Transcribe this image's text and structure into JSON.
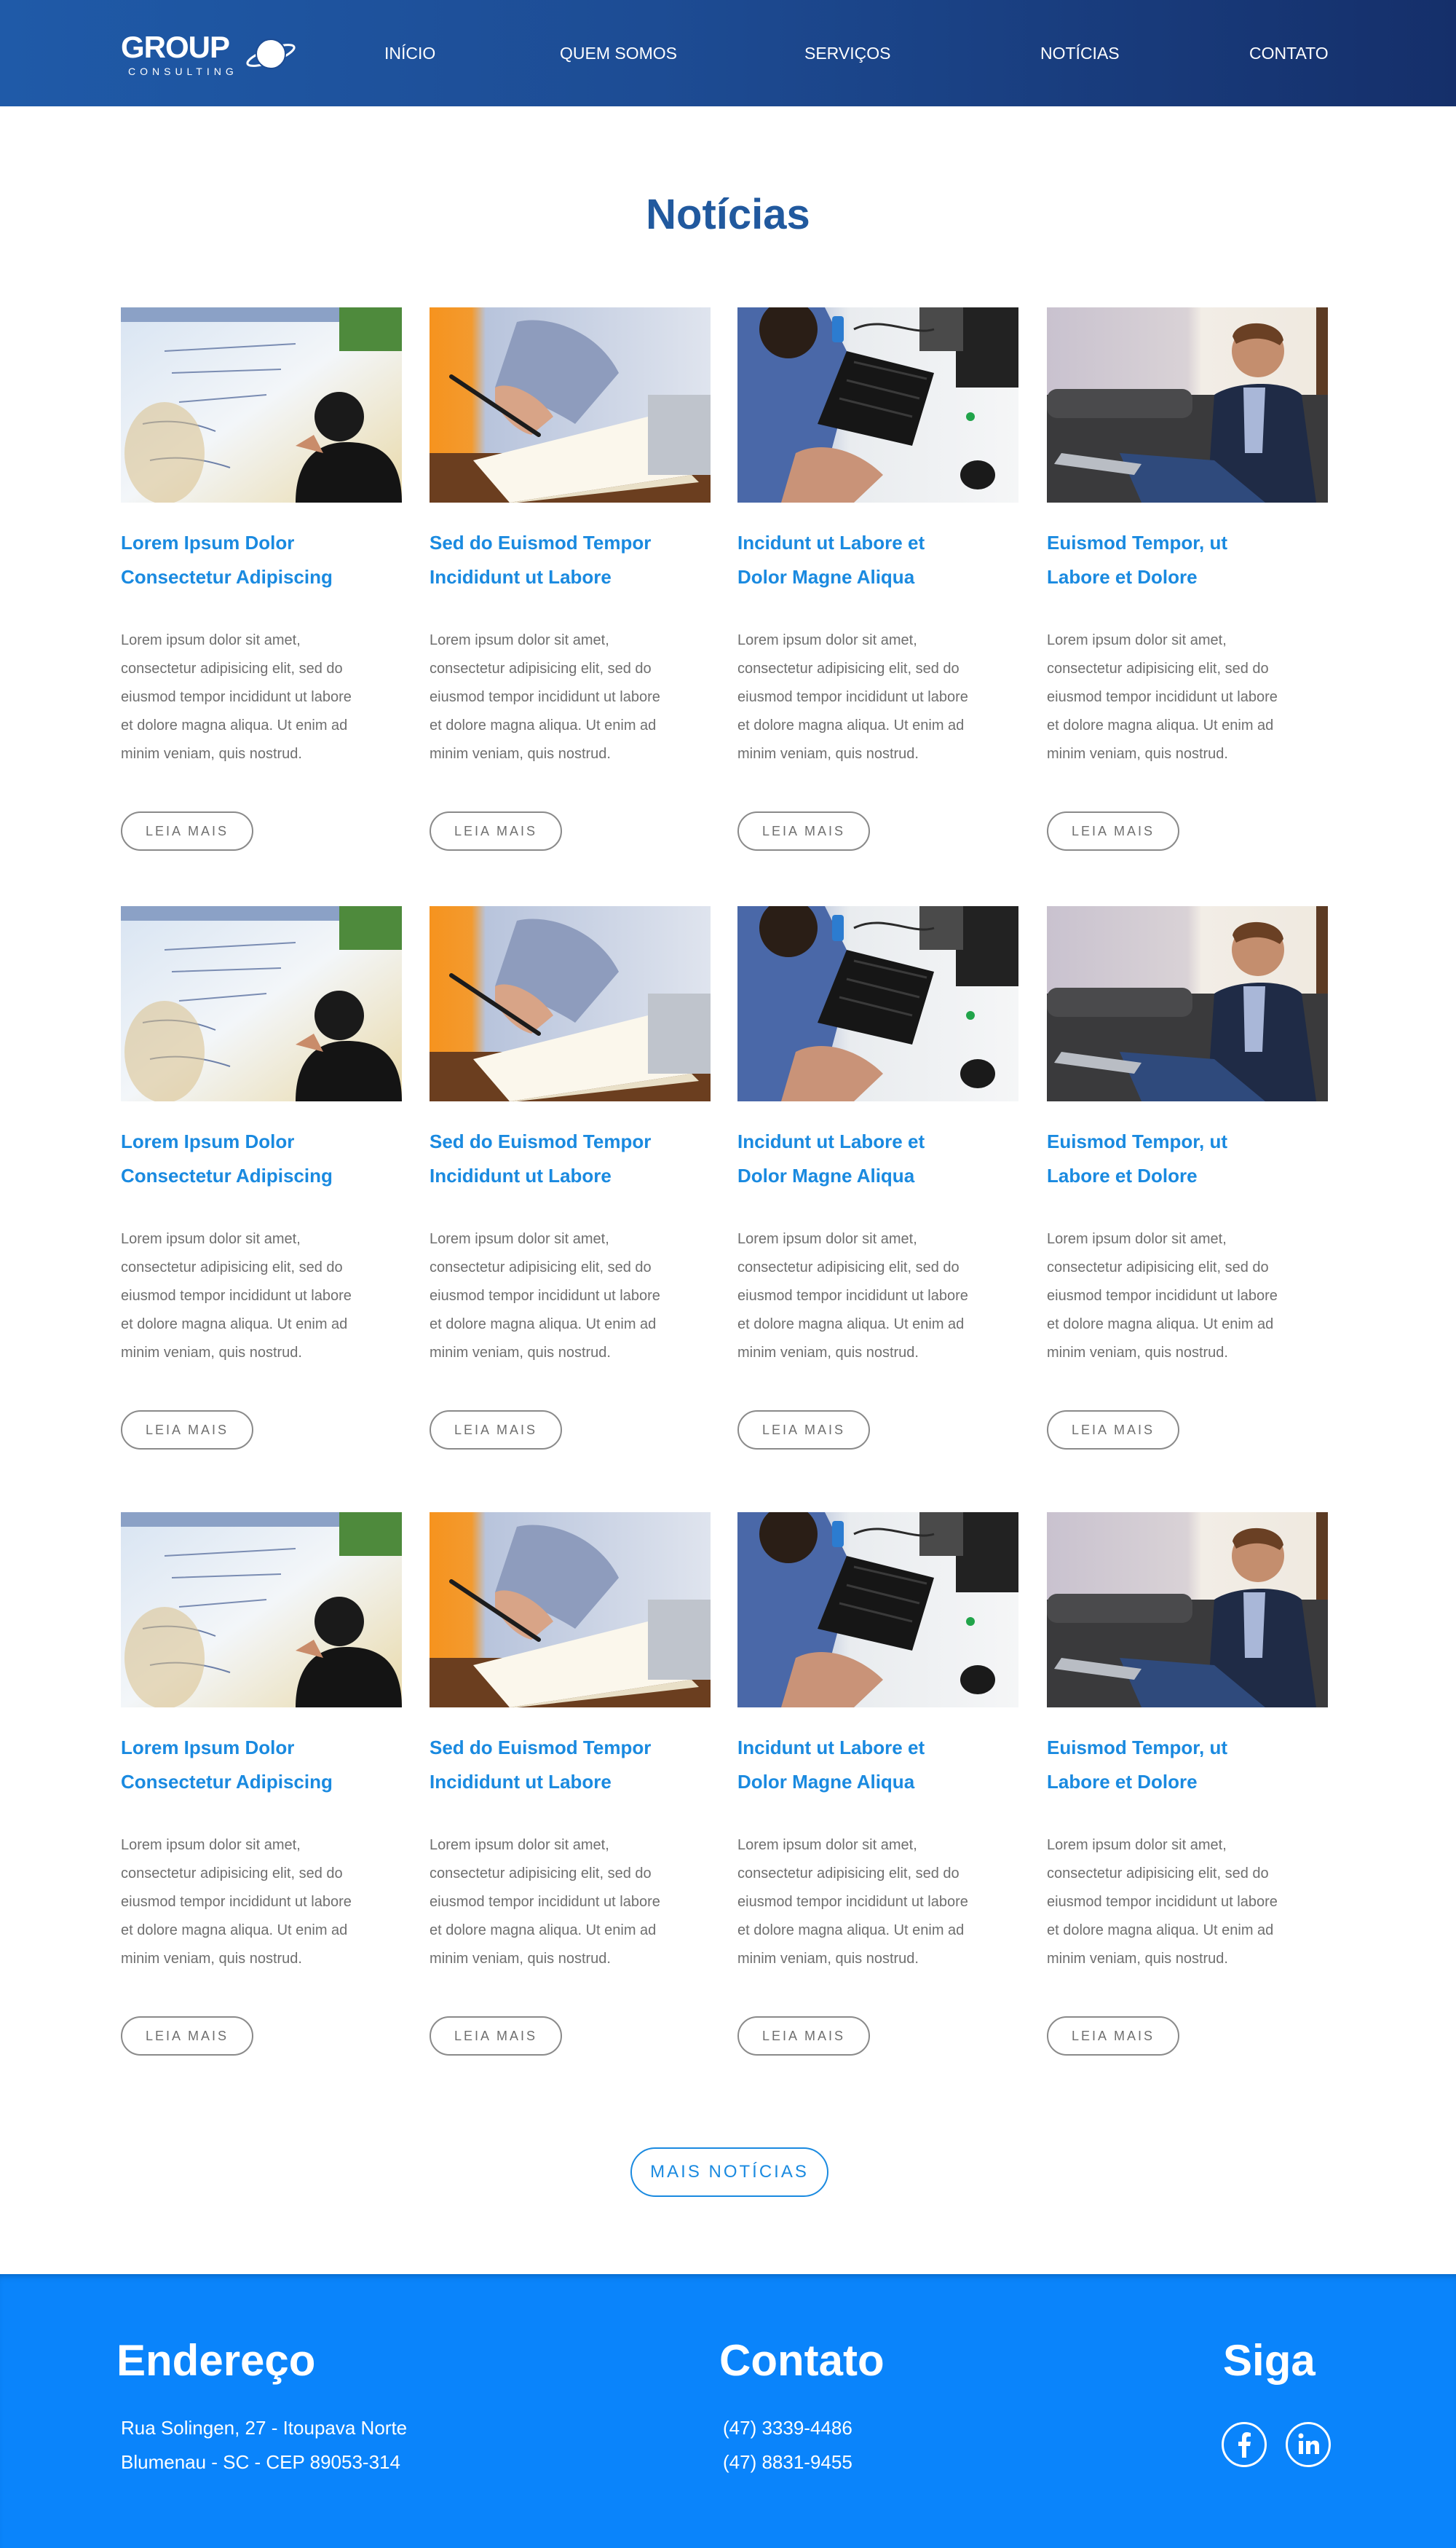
{
  "header": {
    "logo_text": "GROUP",
    "logo_sub": "CONSULTING",
    "nav": [
      "INÍCIO",
      "QUEM SOMOS",
      "SERVIÇOS",
      "NOTÍCIAS",
      "CONTATO"
    ]
  },
  "main": {
    "title": "Notícias",
    "more_label": "MAIS NOTÍCIAS",
    "rows": [
      [
        {
          "image": "whiteboard-photo",
          "title_1": "Lorem Ipsum Dolor",
          "title_2": "Consectetur Adipiscing",
          "text_1": "Lorem ipsum dolor sit amet,",
          "text_2": "consectetur adipisicing elit, sed do",
          "text_3": "eiusmod tempor incididunt ut labore",
          "text_4": "et dolore magna aliqua. Ut enim ad",
          "text_5": "minim veniam, quis nostrud.",
          "button": "LEIA MAIS"
        },
        {
          "image": "writing-photo",
          "title_1": "Sed do Euismod Tempor",
          "title_2": "Incididunt ut Labore",
          "text_1": "Lorem ipsum dolor sit amet,",
          "text_2": "consectetur adipisicing elit, sed do",
          "text_3": "eiusmod tempor incididunt ut labore",
          "text_4": "et dolore magna aliqua. Ut enim ad",
          "text_5": "minim veniam, quis nostrud.",
          "button": "LEIA MAIS"
        },
        {
          "image": "keyboard-photo",
          "title_1": "Incidunt ut Labore et",
          "title_2": "Dolor Magne Aliqua",
          "text_1": "Lorem ipsum dolor sit amet,",
          "text_2": "consectetur adipisicing elit, sed do",
          "text_3": "eiusmod tempor incididunt ut labore",
          "text_4": "et dolore magna aliqua. Ut enim ad",
          "text_5": "minim veniam, quis nostrud.",
          "button": "LEIA MAIS"
        },
        {
          "image": "laptop-man-photo",
          "title_1": "Euismod Tempor, ut",
          "title_2": "Labore et Dolore",
          "text_1": "Lorem ipsum dolor sit amet,",
          "text_2": "consectetur adipisicing elit, sed do",
          "text_3": "eiusmod tempor incididunt ut labore",
          "text_4": "et dolore magna aliqua. Ut enim ad",
          "text_5": "minim veniam, quis nostrud.",
          "button": "LEIA MAIS"
        }
      ],
      [
        {
          "image": "whiteboard-photo",
          "title_1": "Lorem Ipsum Dolor",
          "title_2": "Consectetur Adipiscing",
          "text_1": "Lorem ipsum dolor sit amet,",
          "text_2": "consectetur adipisicing elit, sed do",
          "text_3": "eiusmod tempor incididunt ut labore",
          "text_4": "et dolore magna aliqua. Ut enim ad",
          "text_5": "minim veniam, quis nostrud.",
          "button": "LEIA MAIS"
        },
        {
          "image": "writing-photo",
          "title_1": "Sed do Euismod Tempor",
          "title_2": "Incididunt ut Labore",
          "text_1": "Lorem ipsum dolor sit amet,",
          "text_2": "consectetur adipisicing elit, sed do",
          "text_3": "eiusmod tempor incididunt ut labore",
          "text_4": "et dolore magna aliqua. Ut enim ad",
          "text_5": "minim veniam, quis nostrud.",
          "button": "LEIA MAIS"
        },
        {
          "image": "keyboard-photo",
          "title_1": "Incidunt ut Labore et",
          "title_2": "Dolor Magne Aliqua",
          "text_1": "Lorem ipsum dolor sit amet,",
          "text_2": "consectetur adipisicing elit, sed do",
          "text_3": "eiusmod tempor incididunt ut labore",
          "text_4": "et dolore magna aliqua. Ut enim ad",
          "text_5": "minim veniam, quis nostrud.",
          "button": "LEIA MAIS"
        },
        {
          "image": "laptop-man-photo",
          "title_1": "Euismod Tempor, ut",
          "title_2": "Labore et Dolore",
          "text_1": "Lorem ipsum dolor sit amet,",
          "text_2": "consectetur adipisicing elit, sed do",
          "text_3": "eiusmod tempor incididunt ut labore",
          "text_4": "et dolore magna aliqua. Ut enim ad",
          "text_5": "minim veniam, quis nostrud.",
          "button": "LEIA MAIS"
        }
      ],
      [
        {
          "image": "whiteboard-photo",
          "title_1": "Lorem Ipsum Dolor",
          "title_2": "Consectetur Adipiscing",
          "text_1": "Lorem ipsum dolor sit amet,",
          "text_2": "consectetur adipisicing elit, sed do",
          "text_3": "eiusmod tempor incididunt ut labore",
          "text_4": "et dolore magna aliqua. Ut enim ad",
          "text_5": "minim veniam, quis nostrud.",
          "button": "LEIA MAIS"
        },
        {
          "image": "writing-photo",
          "title_1": "Sed do Euismod Tempor",
          "title_2": "Incididunt ut Labore",
          "text_1": "Lorem ipsum dolor sit amet,",
          "text_2": "consectetur adipisicing elit, sed do",
          "text_3": "eiusmod tempor incididunt ut labore",
          "text_4": "et dolore magna aliqua. Ut enim ad",
          "text_5": "minim veniam, quis nostrud.",
          "button": "LEIA MAIS"
        },
        {
          "image": "keyboard-photo",
          "title_1": "Incidunt ut Labore et",
          "title_2": "Dolor Magne Aliqua",
          "text_1": "Lorem ipsum dolor sit amet,",
          "text_2": "consectetur adipisicing elit, sed do",
          "text_3": "eiusmod tempor incididunt ut labore",
          "text_4": "et dolore magna aliqua. Ut enim ad",
          "text_5": "minim veniam, quis nostrud.",
          "button": "LEIA MAIS"
        },
        {
          "image": "laptop-man-photo",
          "title_1": "Euismod Tempor, ut",
          "title_2": "Labore et Dolore",
          "text_1": "Lorem ipsum dolor sit amet,",
          "text_2": "consectetur adipisicing elit, sed do",
          "text_3": "eiusmod tempor incididunt ut labore",
          "text_4": "et dolore magna aliqua. Ut enim ad",
          "text_5": "minim veniam, quis nostrud.",
          "button": "LEIA MAIS"
        }
      ]
    ]
  },
  "footer": {
    "address_title": "Endereço",
    "address_1": "Rua Solingen, 27 - Itoupava Norte",
    "address_2": "Blumenau - SC - CEP 89053-314",
    "contact_title": "Contato",
    "phone_1": "(47) 3339-4486",
    "phone_2": "(47) 8831-9455",
    "follow_title": "Siga",
    "social": [
      "facebook-icon",
      "linkedin-icon"
    ]
  },
  "colors": {
    "header_start": "#1f5aa8",
    "header_end": "#152f6a",
    "title": "#21599e",
    "accent": "#1a8ae0",
    "footer": "#0a84fb"
  }
}
